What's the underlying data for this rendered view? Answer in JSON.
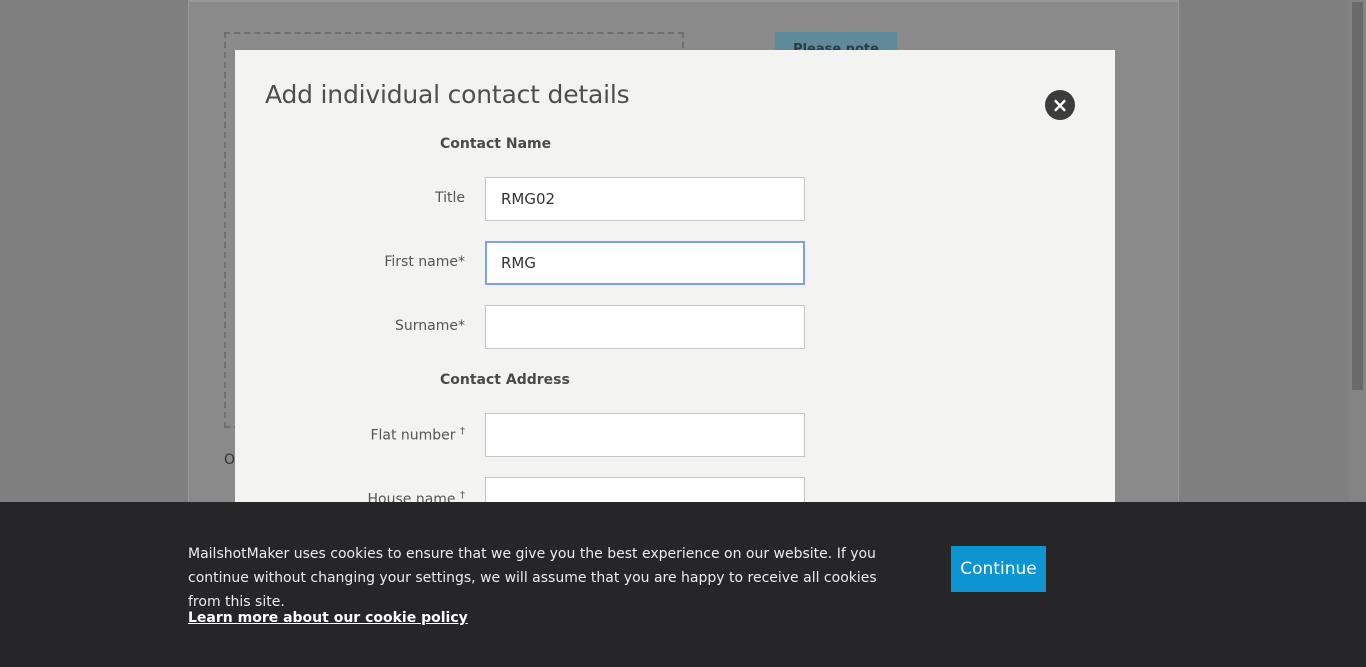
{
  "background": {
    "note_label": "Please note",
    "fragment_text": "O"
  },
  "modal": {
    "title": "Add individual contact details",
    "close_icon": "×",
    "sections": {
      "contact_name": "Contact Name",
      "contact_address": "Contact Address"
    },
    "fields": {
      "title": {
        "label": "Title",
        "value": "RMG02"
      },
      "first_name": {
        "label": "First name*",
        "value": "RMG"
      },
      "surname": {
        "label": "Surname*",
        "value": ""
      },
      "flat_number": {
        "label": "Flat number",
        "marker": "†",
        "value": ""
      },
      "house_name": {
        "label": "House name",
        "marker": "†",
        "value": ""
      }
    }
  },
  "cookie": {
    "message": "MailshotMaker uses cookies to ensure that we give you the best experience on our website. If you continue without changing your settings, we will assume that you are happy to receive all cookies from this site.",
    "link_text": "Learn more about our cookie policy",
    "continue_label": "Continue"
  },
  "colors": {
    "accent_button": "#0d95d1",
    "banner_bg": "#262629",
    "modal_bg": "#f3f3f1",
    "focus_border": "#7ea2e0"
  }
}
